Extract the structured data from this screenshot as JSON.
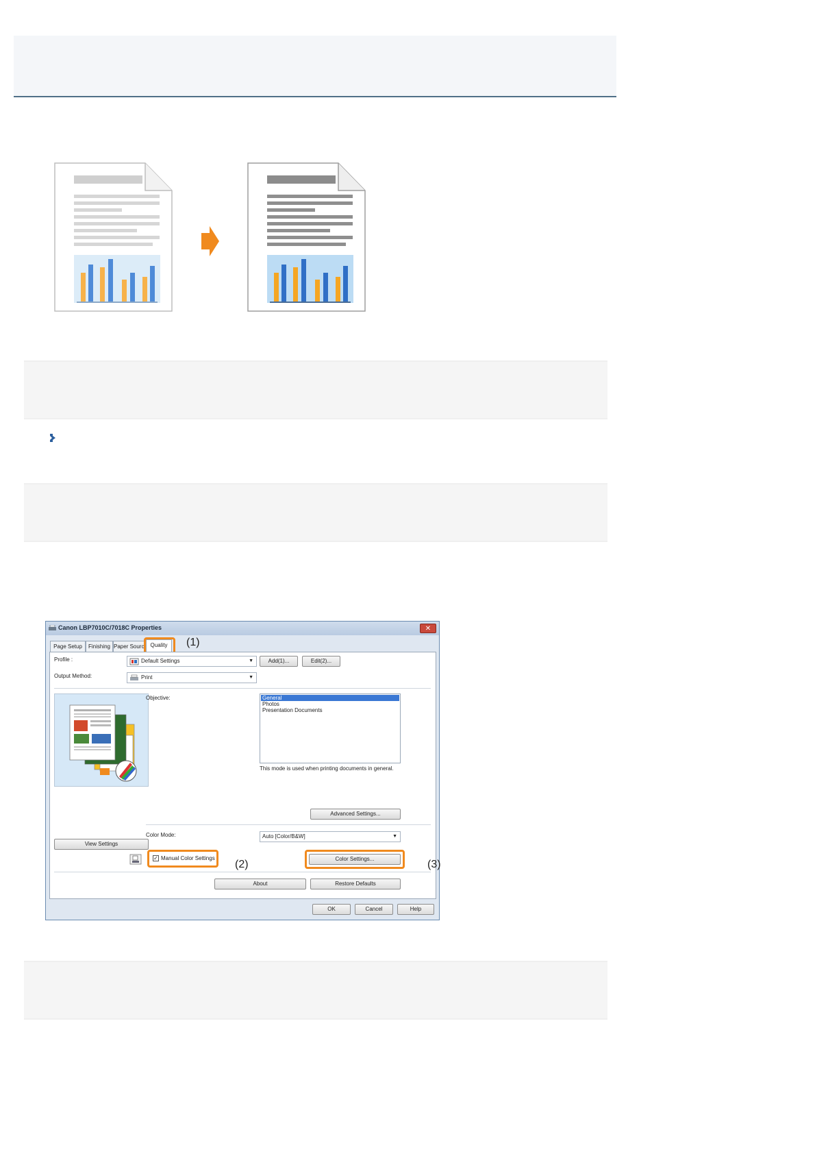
{
  "dialog": {
    "title": "Canon LBP7010C/7018C Properties",
    "close_label": "✕",
    "tabs": [
      "Page Setup",
      "Finishing",
      "Paper Sourc",
      "Quality"
    ],
    "profile_label": "Profile :",
    "profile_value": "Default Settings",
    "add_button": "Add(1)...",
    "edit_button": "Edit(2)...",
    "output_method_label": "Output Method:",
    "output_method_value": "Print",
    "objective_label": "Objective:",
    "objectives": [
      "General",
      "Photos",
      "Presentation Documents"
    ],
    "objective_selected": "General",
    "objective_description": "This mode is used when printing documents in general.",
    "advanced_settings_button": "Advanced Settings...",
    "color_mode_label": "Color Mode:",
    "color_mode_value": "Auto [Color/B&W]",
    "view_settings_button": "View Settings",
    "manual_color_checkbox": "Manual Color Settings",
    "manual_color_checked": true,
    "color_settings_button": "Color Settings...",
    "about_button": "About",
    "restore_defaults_button": "Restore Defaults",
    "ok_button": "OK",
    "cancel_button": "Cancel",
    "help_button": "Help"
  },
  "callouts": [
    "(1)",
    "(2)",
    "(3)"
  ],
  "colors": {
    "accent_arrow": "#f08a1e",
    "highlight": "#f08a1e",
    "bar_orange": "#f5a623",
    "bar_blue": "#2f6fc6",
    "header_rule": "#4f6f87"
  },
  "icons": {
    "arrow": "right-arrow-icon",
    "bullet": "link-bullet-icon"
  }
}
